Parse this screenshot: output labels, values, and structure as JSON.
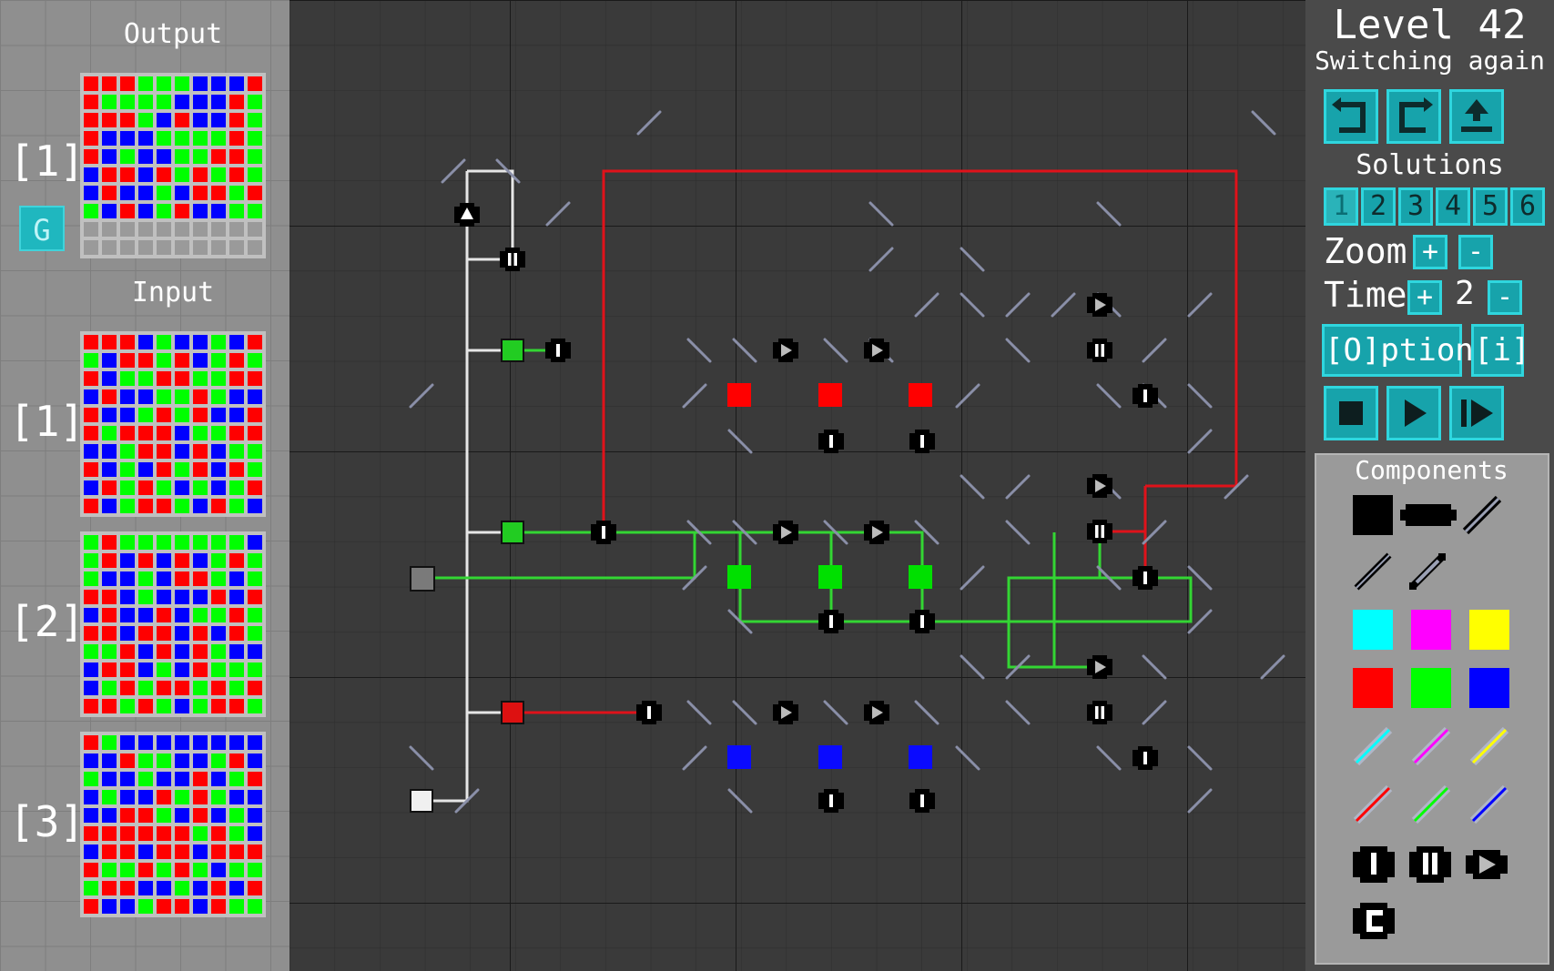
{
  "level": {
    "title": "Level 42",
    "subtitle": "Switching again"
  },
  "left_panel": {
    "output_label": "Output",
    "input_label": "Input",
    "output_index": "[1]",
    "g_button": "G",
    "input_indices": [
      "[1]",
      "[2]",
      "[3]"
    ]
  },
  "toolbar": {
    "undo_icon": "undo-icon",
    "redo_icon": "redo-icon",
    "upload_icon": "upload-icon"
  },
  "solutions": {
    "label": "Solutions",
    "slots": [
      "1",
      "2",
      "3",
      "4",
      "5",
      "6"
    ],
    "active": "1"
  },
  "zoom": {
    "label": "Zoom",
    "plus": "+",
    "minus": "-"
  },
  "time": {
    "label": "Time",
    "plus": "+",
    "value": "2",
    "minus": "-"
  },
  "options_button": "[O]ptions",
  "info_button": "[i]",
  "playback": {
    "stop_icon": "stop-icon",
    "play_icon": "play-icon",
    "step_icon": "step-icon"
  },
  "components": {
    "title": "Components",
    "colors": {
      "cyan": "#00ffff",
      "magenta": "#ff00ff",
      "yellow": "#ffff00",
      "red": "#ff0000",
      "green": "#00ff00",
      "blue": "#0000ff"
    }
  },
  "patterns": {
    "output": [
      "RRRGGGBBBR",
      "RGGGGBBBRG",
      "RRRGBRBBRG",
      "RBBBGGGGRG",
      "RBGBBGGRRG",
      "BRRBRGRGRG",
      "BRBBGBRRGR",
      "GBRBGRBBGG",
      "WWWWWWWWWW",
      "WWWWWWWWWW"
    ],
    "input1": [
      "RRRBGBBGBR",
      "GBRRGRBGRG",
      "RBGGRRGGRR",
      "BRBBGGRGBB",
      "RBBGRGRBBR",
      "RGRRRBGGRR",
      "BBGRRBRBGG",
      "RBGBRGRBRG",
      "BRGRGBGBGR",
      "RBGRRGBRGB"
    ],
    "input2": [
      "GRGGGGGGGB",
      "GRBRBRBGRG",
      "GBBGBRRGBG",
      "RRBGBBBRBR",
      "BRBBRBGGRG",
      "RRBRRBRBRG",
      "GGRBRBRGBB",
      "BRRBGBRGGG",
      "BGRGRRGRGR",
      "RRGRGBGRRG"
    ],
    "input3": [
      "RGBBBBBBBB",
      "BBRGGBBGRB",
      "GBBGBBRBGR",
      "BGBBRGRGBB",
      "BBRRGBRBGB",
      "RRRRRRGRGB",
      "BRRBRRBRRR",
      "RGGRGRGBGG",
      "GRRBBGBRBR",
      "RBBGRRBRGG"
    ]
  }
}
